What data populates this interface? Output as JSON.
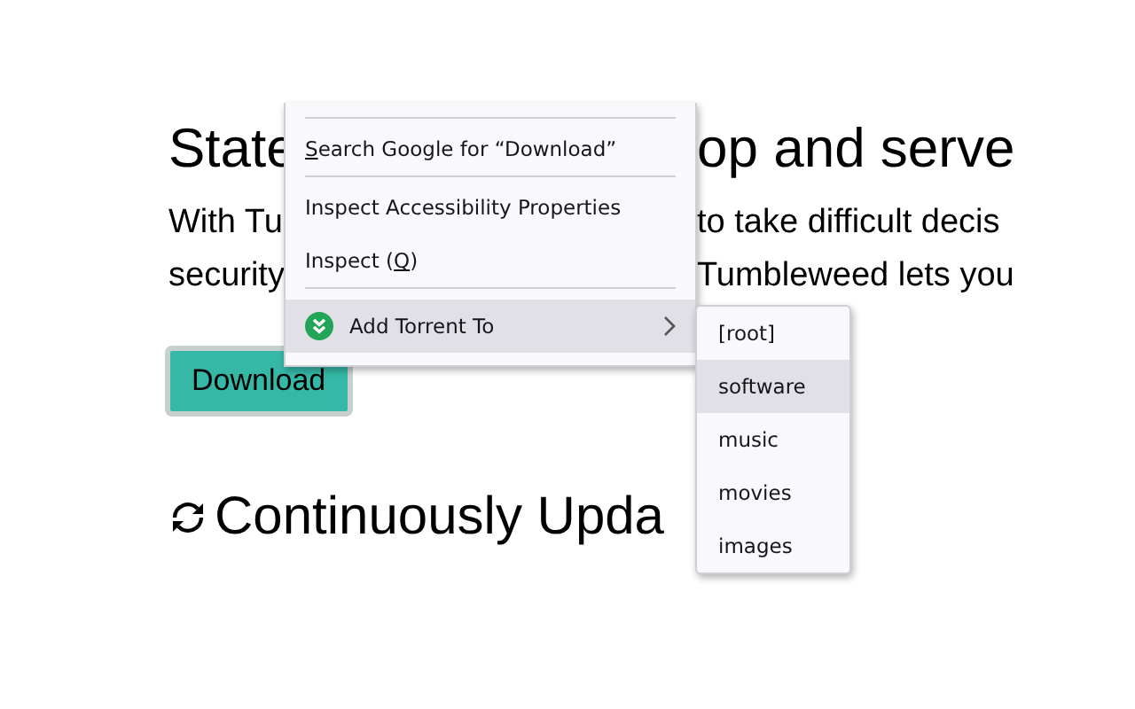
{
  "page": {
    "heading_left": "State",
    "heading_right": "op and serve",
    "paragraph_lines": [
      {
        "left": "With Tu",
        "right": "to take difficult decis"
      },
      {
        "left": "security",
        "right": "Tumbleweed lets you"
      }
    ],
    "download_button": "Download",
    "section_heading": "Continuously Upda"
  },
  "context_menu": {
    "items": [
      {
        "kind": "separator"
      },
      {
        "kind": "item",
        "key": "S",
        "after": "earch Google for “Download”"
      },
      {
        "kind": "separator"
      },
      {
        "kind": "item",
        "before": "Inspect Accessibility Properties"
      },
      {
        "kind": "item",
        "before": "Inspect (",
        "key": "Q",
        "after": ")"
      },
      {
        "kind": "separator"
      },
      {
        "kind": "submenu",
        "before": "Add Torrent To",
        "selected": true
      }
    ]
  },
  "submenu": {
    "items": [
      {
        "label": "[root]",
        "selected": false
      },
      {
        "label": "software",
        "selected": true
      },
      {
        "label": "music",
        "selected": false
      },
      {
        "label": "movies",
        "selected": false
      },
      {
        "label": "images",
        "selected": false
      }
    ]
  }
}
